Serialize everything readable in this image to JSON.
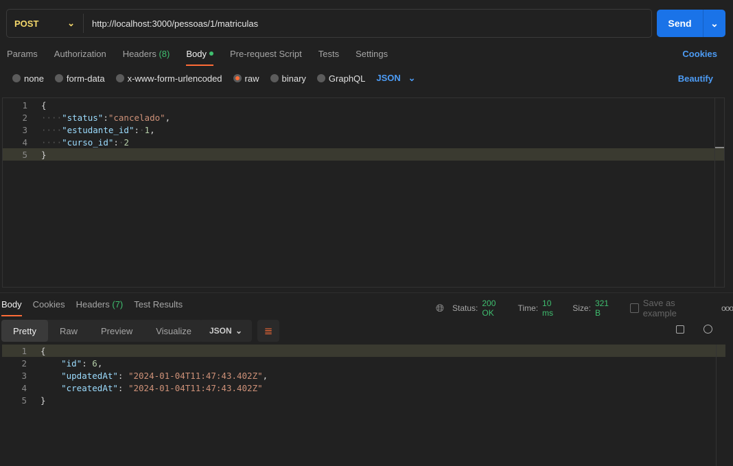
{
  "request": {
    "method": "POST",
    "url": "http://localhost:3000/pessoas/1/matriculas",
    "send_label": "Send"
  },
  "req_tabs": [
    {
      "label": "Params"
    },
    {
      "label": "Authorization"
    },
    {
      "label": "Headers",
      "count": "(8)"
    },
    {
      "label": "Body"
    },
    {
      "label": "Pre-request Script"
    },
    {
      "label": "Tests"
    },
    {
      "label": "Settings"
    }
  ],
  "cookies_link": "Cookies",
  "body_types": [
    {
      "label": "none"
    },
    {
      "label": "form-data"
    },
    {
      "label": "x-www-form-urlencoded"
    },
    {
      "label": "raw",
      "selected": true
    },
    {
      "label": "binary"
    },
    {
      "label": "GraphQL"
    }
  ],
  "body_format": "JSON",
  "beautify": "Beautify",
  "request_body": [
    [
      {
        "t": "{",
        "c": ""
      }
    ],
    [
      {
        "t": "····",
        "c": "ws"
      },
      {
        "t": "\"status\"",
        "c": "k"
      },
      {
        "t": ":",
        "c": ""
      },
      {
        "t": "\"cancelado\"",
        "c": "s"
      },
      {
        "t": ",",
        "c": ""
      }
    ],
    [
      {
        "t": "····",
        "c": "ws"
      },
      {
        "t": "\"estudante_id\"",
        "c": "k"
      },
      {
        "t": ":",
        "c": ""
      },
      {
        "t": "·",
        "c": "ws"
      },
      {
        "t": "1",
        "c": "n"
      },
      {
        "t": ",",
        "c": ""
      }
    ],
    [
      {
        "t": "····",
        "c": "ws"
      },
      {
        "t": "\"curso_id\"",
        "c": "k"
      },
      {
        "t": ":",
        "c": ""
      },
      {
        "t": "·",
        "c": "ws"
      },
      {
        "t": "2",
        "c": "n"
      }
    ],
    [
      {
        "t": "}",
        "c": ""
      }
    ]
  ],
  "res_tabs": [
    {
      "label": "Body"
    },
    {
      "label": "Cookies"
    },
    {
      "label": "Headers",
      "count": "(7)"
    },
    {
      "label": "Test Results"
    }
  ],
  "status": {
    "status_label": "Status:",
    "status": "200 OK",
    "time_label": "Time:",
    "time": "10 ms",
    "size_label": "Size:",
    "size": "321 B",
    "save": "Save as example"
  },
  "views": [
    "Pretty",
    "Raw",
    "Preview",
    "Visualize"
  ],
  "res_format": "JSON",
  "response_body": [
    [
      {
        "t": "{",
        "c": ""
      }
    ],
    [
      {
        "t": "    ",
        "c": ""
      },
      {
        "t": "\"id\"",
        "c": "k"
      },
      {
        "t": ": ",
        "c": ""
      },
      {
        "t": "6",
        "c": "n"
      },
      {
        "t": ",",
        "c": ""
      }
    ],
    [
      {
        "t": "    ",
        "c": ""
      },
      {
        "t": "\"updatedAt\"",
        "c": "k"
      },
      {
        "t": ": ",
        "c": ""
      },
      {
        "t": "\"2024-01-04T11:47:43.402Z\"",
        "c": "s"
      },
      {
        "t": ",",
        "c": ""
      }
    ],
    [
      {
        "t": "    ",
        "c": ""
      },
      {
        "t": "\"createdAt\"",
        "c": "k"
      },
      {
        "t": ": ",
        "c": ""
      },
      {
        "t": "\"2024-01-04T11:47:43.402Z\"",
        "c": "s"
      }
    ],
    [
      {
        "t": "}",
        "c": ""
      }
    ]
  ]
}
